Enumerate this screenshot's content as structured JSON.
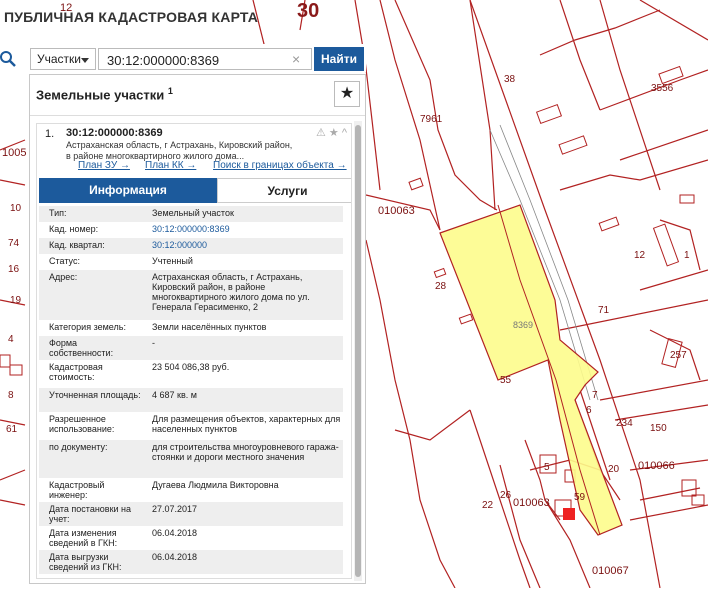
{
  "app": {
    "title": "ПУБЛИЧНАЯ КАДАСТРОВАЯ КАРТА"
  },
  "search": {
    "type_label": "Участки",
    "query": "30:12:000000:8369",
    "clear": "×",
    "button": "Найти"
  },
  "panel": {
    "title": "Земельные участки",
    "title_sup": "1",
    "favorite": "★"
  },
  "result": {
    "number": "1.",
    "cad_number": "30:12:000000:8369",
    "address": "Астраханская область, г Астрахань, Кировский район, в районе многоквартирного жилого дома...",
    "links": {
      "plan_zu": "План ЗУ →",
      "plan_kk": "План КК →",
      "search_bounds": "Поиск в границах объекта →"
    },
    "icons": "⚠ ★ ^"
  },
  "tabs": {
    "info": "Информация",
    "services": "Услуги"
  },
  "attributes": [
    {
      "label": "Тип:",
      "value": "Земельный участок"
    },
    {
      "label": "Кад. номер:",
      "value": "30:12:000000:8369"
    },
    {
      "label": "Кад. квартал:",
      "value": "30:12:000000"
    },
    {
      "label": "Статус:",
      "value": "Учтенный"
    },
    {
      "label": "Адрес:",
      "value": "Астраханская область, г Астрахань, Кировский район, в районе многоквартирного жилого дома по ул. Генерала Герасименко, 2"
    },
    {
      "label": "Категория земель:",
      "value": "Земли населённых пунктов"
    },
    {
      "label": "Форма собственности:",
      "value": "-"
    },
    {
      "label": "Кадастровая стоимость:",
      "value": "23 504 086,38 руб."
    },
    {
      "label": "Уточненная площадь:",
      "value": "4 687 кв. м"
    },
    {
      "label": "Разрешенное использование:",
      "value": "Для размещения объектов, характерных для населенных пунктов"
    },
    {
      "label": "по документу:",
      "value": "для строительства многоуровневого гаража-стоянки и дороги местного значения"
    },
    {
      "label": "Кадастровый инженер:",
      "value": "Дугаева Людмила Викторовна"
    },
    {
      "label": "Дата постановки на учет:",
      "value": "27.07.2017"
    },
    {
      "label": "Дата изменения сведений в ГКН:",
      "value": "06.04.2018"
    },
    {
      "label": "Дата выгрузки сведений из ГКН:",
      "value": "06.04.2018"
    }
  ],
  "map_labels": {
    "l30": "30",
    "l12": "12",
    "l38": "38",
    "l3556": "3556",
    "l7961": "7961",
    "l1005": "1005",
    "l010063a": "010063",
    "l28": "28",
    "l8369": "8369",
    "l71": "71",
    "l4": "4",
    "l150": "150",
    "l010066": "010066",
    "l010063b": "010063",
    "l010067": "010067",
    "l5": "5",
    "l26": "26",
    "l22": "22",
    "l20": "20",
    "l234": "234",
    "l257": "257",
    "l61": "61",
    "l74": "74",
    "l19": "19",
    "l10": "10",
    "l16": "16",
    "l8": "8",
    "l55": "55",
    "l1": "1",
    "l12b": "12",
    "l59": "59",
    "l6": "6",
    "l7": "7"
  },
  "colors": {
    "accent": "#1c5a9c",
    "parcel_fill": "#fdfc8c",
    "boundary": "#b22222"
  }
}
